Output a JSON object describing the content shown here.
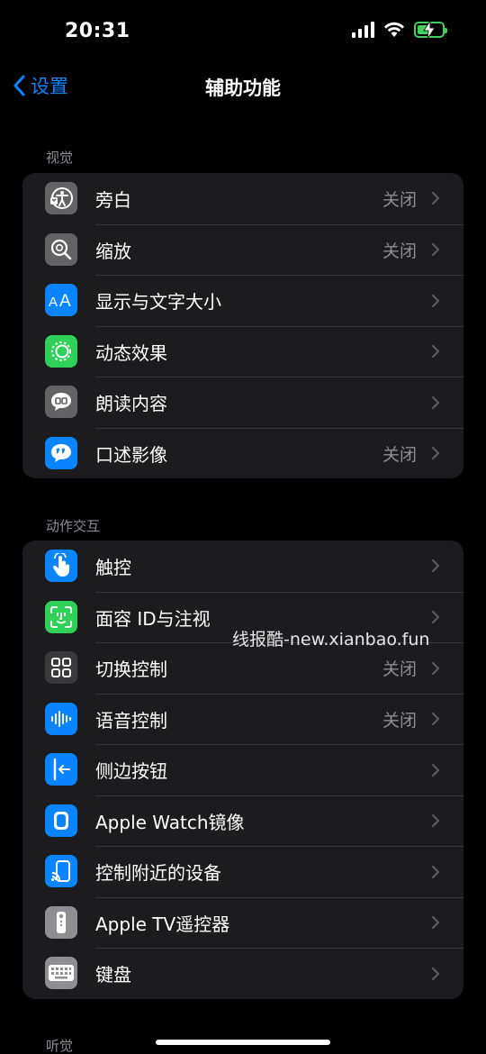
{
  "status_bar": {
    "time": "20:31"
  },
  "nav": {
    "back_label": "设置",
    "title": "辅助功能"
  },
  "sections": [
    {
      "header": "视觉",
      "items": [
        {
          "label": "旁白",
          "value": "关闭",
          "icon": "voiceover-icon",
          "color": "#636366"
        },
        {
          "label": "缩放",
          "value": "关闭",
          "icon": "zoom-icon",
          "color": "#636366"
        },
        {
          "label": "显示与文字大小",
          "value": "",
          "icon": "text-size-icon",
          "color": "#0a84ff"
        },
        {
          "label": "动态效果",
          "value": "",
          "icon": "motion-icon",
          "color": "#30d158"
        },
        {
          "label": "朗读内容",
          "value": "",
          "icon": "spoken-content-icon",
          "color": "#636366"
        },
        {
          "label": "口述影像",
          "value": "关闭",
          "icon": "audio-description-icon",
          "color": "#0a84ff"
        }
      ]
    },
    {
      "header": "动作交互",
      "items": [
        {
          "label": "触控",
          "value": "",
          "icon": "touch-icon",
          "color": "#0a84ff"
        },
        {
          "label": "面容 ID与注视",
          "value": "",
          "icon": "face-id-icon",
          "color": "#30d158"
        },
        {
          "label": "切换控制",
          "value": "关闭",
          "icon": "switch-control-icon",
          "color": "#3a3a3c"
        },
        {
          "label": "语音控制",
          "value": "关闭",
          "icon": "voice-control-icon",
          "color": "#0a84ff"
        },
        {
          "label": "侧边按钮",
          "value": "",
          "icon": "side-button-icon",
          "color": "#0a84ff"
        },
        {
          "label": "Apple Watch镜像",
          "value": "",
          "icon": "watch-mirroring-icon",
          "color": "#0a84ff"
        },
        {
          "label": "控制附近的设备",
          "value": "",
          "icon": "nearby-devices-icon",
          "color": "#0a84ff"
        },
        {
          "label": "Apple TV遥控器",
          "value": "",
          "icon": "tv-remote-icon",
          "color": "#8e8e93"
        },
        {
          "label": "键盘",
          "value": "",
          "icon": "keyboard-icon",
          "color": "#8e8e93"
        }
      ]
    },
    {
      "header": "听觉",
      "items": []
    }
  ],
  "watermark": "线报酷-new.xianbao.fun"
}
